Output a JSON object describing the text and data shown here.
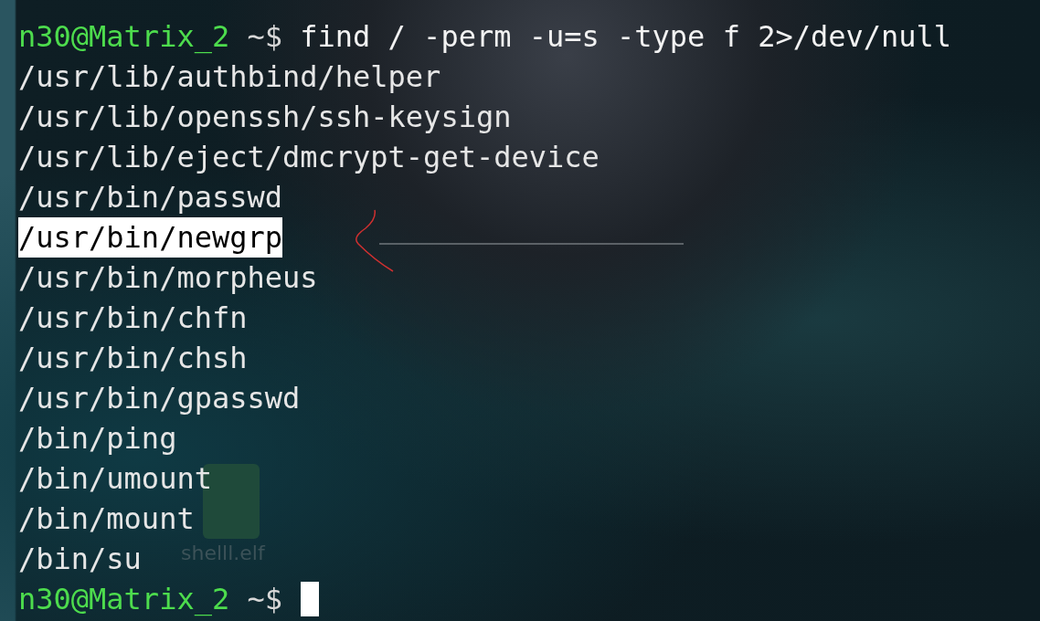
{
  "desktop_labels": [
    {
      "text": "shelll.elf"
    }
  ],
  "terminal": {
    "lines": [
      {
        "kind": "prompt",
        "user_host": "n30@Matrix_2",
        "path": "~$",
        "command": "find / -perm -u=s -type f 2>/dev/null"
      },
      {
        "kind": "output",
        "text": "/usr/lib/authbind/helper",
        "selected": false
      },
      {
        "kind": "output",
        "text": "/usr/lib/openssh/ssh-keysign",
        "selected": false
      },
      {
        "kind": "output",
        "text": "/usr/lib/eject/dmcrypt-get-device",
        "selected": false
      },
      {
        "kind": "output",
        "text": "/usr/bin/passwd",
        "selected": false
      },
      {
        "kind": "output",
        "text": "/usr/bin/newgrp",
        "selected": true
      },
      {
        "kind": "output",
        "text": "/usr/bin/morpheus",
        "selected": false
      },
      {
        "kind": "output",
        "text": "/usr/bin/chfn",
        "selected": false
      },
      {
        "kind": "output",
        "text": "/usr/bin/chsh",
        "selected": false
      },
      {
        "kind": "output",
        "text": "/usr/bin/gpasswd",
        "selected": false
      },
      {
        "kind": "output",
        "text": "/bin/ping",
        "selected": false
      },
      {
        "kind": "output",
        "text": "/bin/umount",
        "selected": false
      },
      {
        "kind": "output",
        "text": "/bin/mount",
        "selected": false
      },
      {
        "kind": "output",
        "text": "/bin/su",
        "selected": false
      },
      {
        "kind": "prompt",
        "user_host": "n30@Matrix_2",
        "path": "~$",
        "cursor": true
      }
    ]
  }
}
